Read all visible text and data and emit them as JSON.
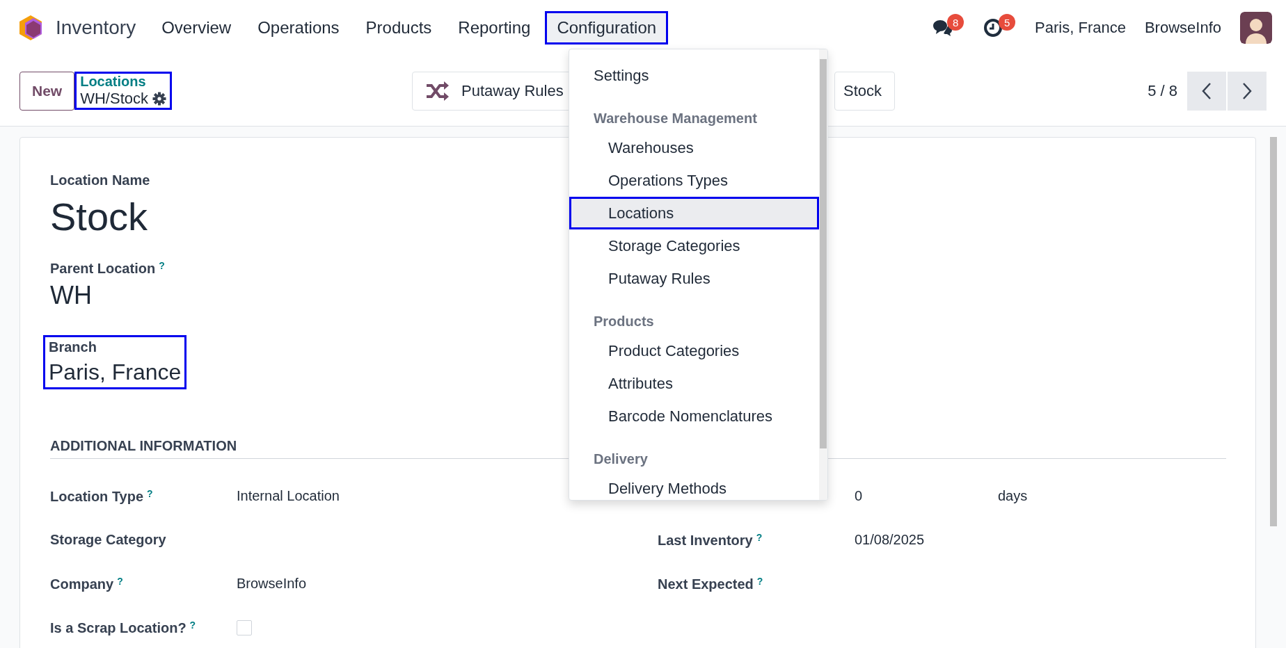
{
  "navbar": {
    "app_name": "Inventory",
    "menu": [
      {
        "label": "Overview",
        "highlighted": false
      },
      {
        "label": "Operations",
        "highlighted": false
      },
      {
        "label": "Products",
        "highlighted": false
      },
      {
        "label": "Reporting",
        "highlighted": false
      },
      {
        "label": "Configuration",
        "highlighted": true
      }
    ],
    "messages_badge": "8",
    "activities_badge": "5",
    "branch": "Paris, France",
    "company": "BrowseInfo"
  },
  "control_panel": {
    "new_button": "New",
    "breadcrumb": {
      "parent": "Locations",
      "current": "WH/Stock",
      "highlighted": true
    },
    "smart_buttons": [
      "Putaway Rules",
      "Stock"
    ],
    "pager": "5 / 8"
  },
  "form": {
    "name_label": "Location Name",
    "name": "Stock",
    "parent_label": "Parent Location",
    "parent_help": "?",
    "parent": "WH",
    "branch": {
      "label": "Branch",
      "value": "Paris, France",
      "highlighted": true
    },
    "section_title": "ADDITIONAL INFORMATION",
    "left_fields": [
      {
        "kind": "text",
        "label": "Location Type",
        "help": "?",
        "value": "Internal Location"
      },
      {
        "kind": "text",
        "label": "Storage Category"
      },
      {
        "kind": "text",
        "label": "Company",
        "help": "?",
        "value": "BrowseInfo"
      },
      {
        "kind": "checkbox",
        "label": "Is a Scrap Location?",
        "help": "?",
        "checked": false
      }
    ],
    "right_fields": [
      {
        "value": "0",
        "unit": "days"
      },
      {
        "label": "Last Inventory",
        "help": "?",
        "value": "01/08/2025"
      },
      {
        "label": "Next Expected",
        "help": "?"
      }
    ]
  },
  "dropdown": {
    "items": [
      {
        "kind": "item",
        "label": "Settings",
        "selected": false,
        "highlighted": false
      },
      {
        "kind": "header",
        "label": "Warehouse Management"
      },
      {
        "kind": "item",
        "label": "Warehouses",
        "selected": false,
        "highlighted": false
      },
      {
        "kind": "item",
        "label": "Operations Types",
        "selected": false,
        "highlighted": false
      },
      {
        "kind": "item",
        "label": "Locations",
        "selected": true,
        "highlighted": true
      },
      {
        "kind": "item",
        "label": "Storage Categories",
        "selected": false,
        "highlighted": false
      },
      {
        "kind": "item",
        "label": "Putaway Rules",
        "selected": false,
        "highlighted": false
      },
      {
        "kind": "header",
        "label": "Products"
      },
      {
        "kind": "item",
        "label": "Product Categories",
        "selected": false,
        "highlighted": false
      },
      {
        "kind": "item",
        "label": "Attributes",
        "selected": false,
        "highlighted": false
      },
      {
        "kind": "item",
        "label": "Barcode Nomenclatures",
        "selected": false,
        "highlighted": false
      },
      {
        "kind": "header",
        "label": "Delivery"
      },
      {
        "kind": "item",
        "label": "Delivery Methods",
        "selected": false,
        "highlighted": false
      }
    ]
  }
}
